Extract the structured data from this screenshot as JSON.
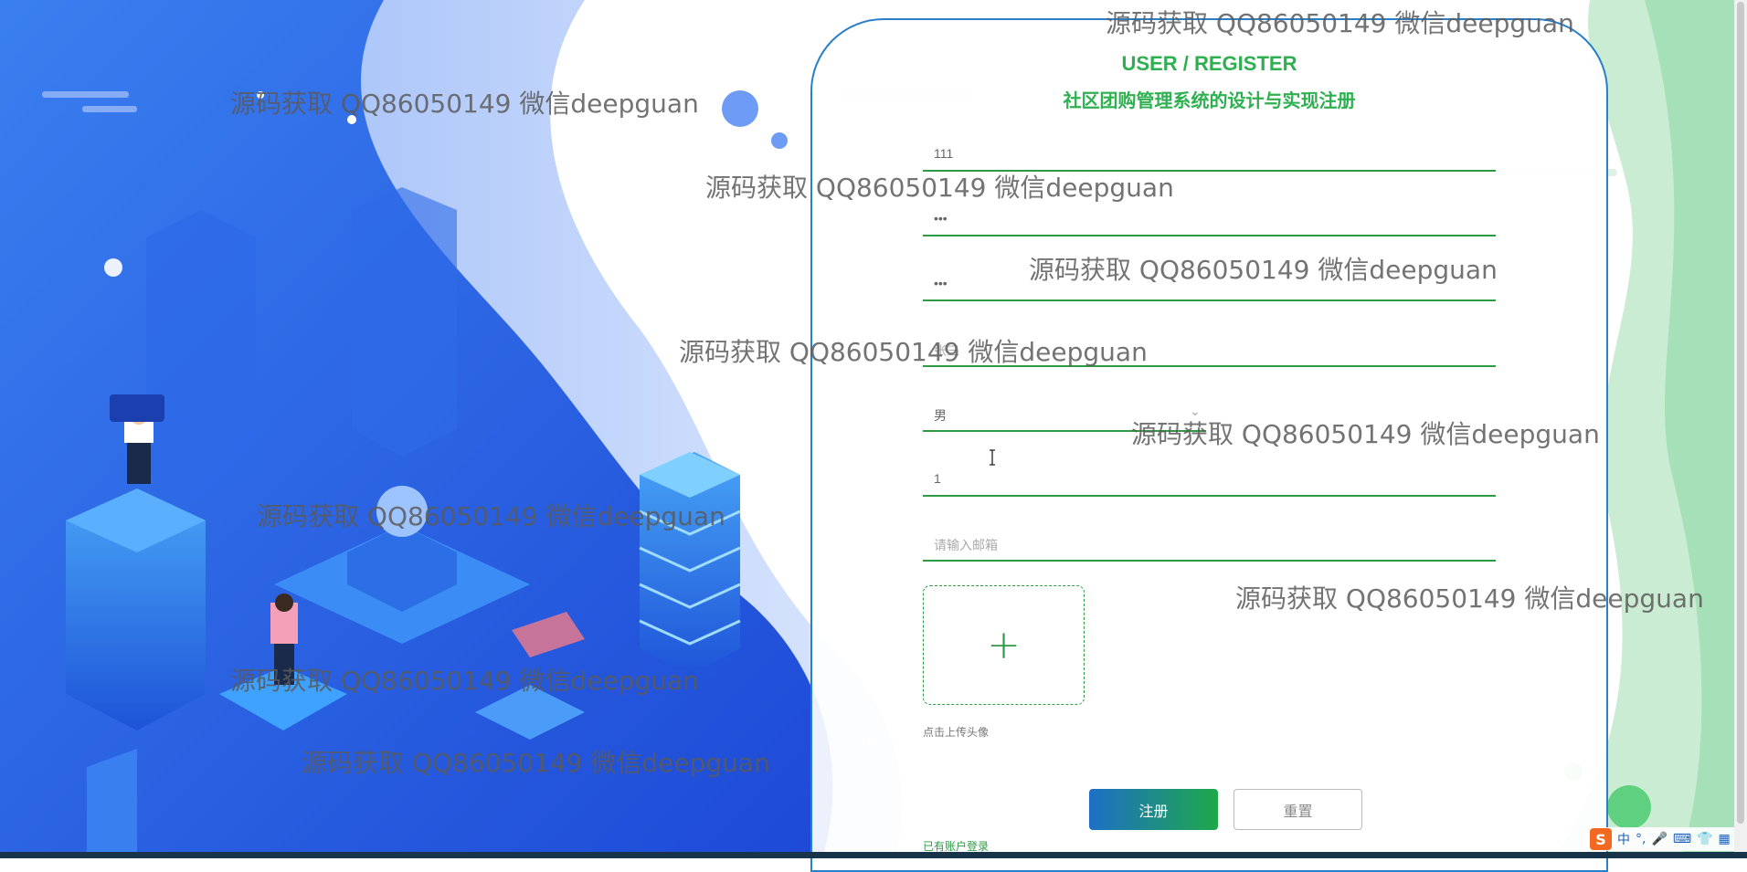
{
  "colors": {
    "accent_green": "#2eb050",
    "field_line": "#2e9a44",
    "panel_border": "#2a7fc9",
    "bg_blue": "#2f6ee8"
  },
  "header": {
    "title_en": "USER / REGISTER",
    "title_cn": "社区团购管理系统的设计与实现注册"
  },
  "form": {
    "fields": [
      {
        "name": "account",
        "value": "111",
        "placeholder": ""
      },
      {
        "name": "password",
        "value": "•••",
        "placeholder": ""
      },
      {
        "name": "confirm-password",
        "value": "•••",
        "placeholder": ""
      },
      {
        "name": "name",
        "value": "",
        "placeholder": "张三"
      },
      {
        "name": "gender",
        "value": "男",
        "placeholder": "",
        "icon": "chevron-down-icon"
      },
      {
        "name": "phone",
        "value": "1",
        "placeholder": ""
      },
      {
        "name": "email",
        "value": "",
        "placeholder": "请输入邮箱"
      }
    ],
    "upload_icon": "plus-icon",
    "upload_hint": "点击上传头像",
    "register_button": "注册",
    "reset_button": "重置",
    "login_link": "已有账户登录"
  },
  "watermarks": [
    "源码获取 QQ86050149 微信deepguan",
    "源码获取 QQ86050149 微信deepguan",
    "源码获取 QQ86050149 微信deepguan",
    "源码获取 QQ86050149 微信deepguan",
    "源码获取 QQ86050149 微信deepguan",
    "源码获取 QQ86050149 微信deepguan",
    "源码获取 QQ86050149 微信deepguan",
    "源码获取 QQ86050149 微信deepguan",
    "源码获取 QQ86050149 微信deepguan",
    "源码获取 QQ86050149 微信deepguan"
  ],
  "ime": {
    "logo": "S",
    "mode": "中",
    "punct": "°,",
    "icons": [
      "microphone-icon",
      "keyboard-icon",
      "shirt-icon",
      "grid-icon"
    ]
  }
}
